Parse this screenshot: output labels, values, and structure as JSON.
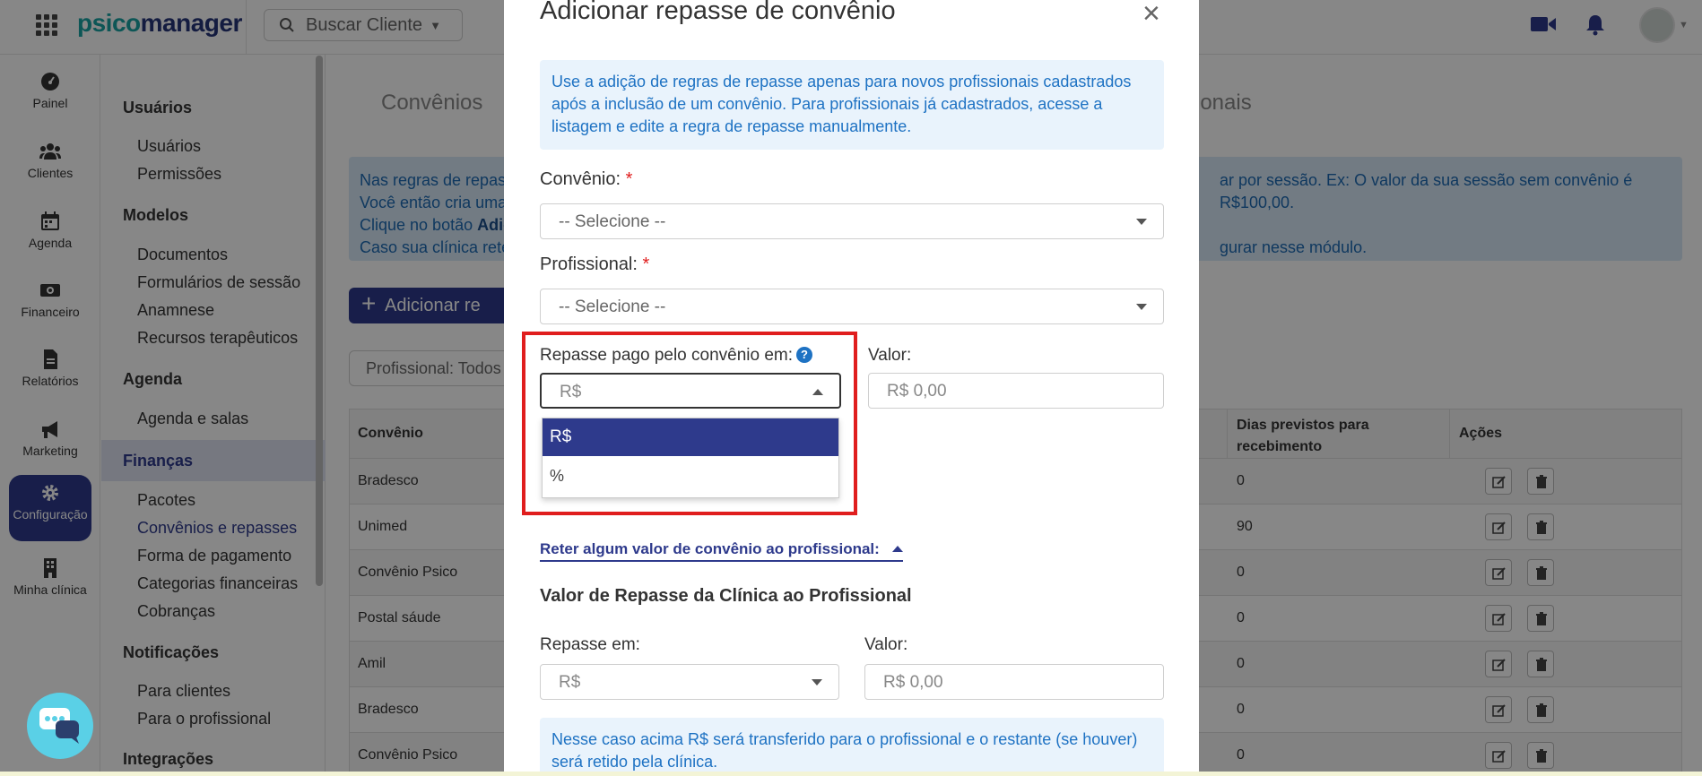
{
  "header": {
    "logo_part1": "psico",
    "logo_part2": "manager",
    "search_label": "Buscar Cliente"
  },
  "rail": [
    {
      "label": "Painel",
      "icon": "gauge-icon"
    },
    {
      "label": "Clientes",
      "icon": "users-icon"
    },
    {
      "label": "Agenda",
      "icon": "calendar-icon"
    },
    {
      "label": "Financeiro",
      "icon": "money-icon"
    },
    {
      "label": "Relatórios",
      "icon": "document-icon"
    },
    {
      "label": "Marketing",
      "icon": "megaphone-icon"
    },
    {
      "label": "Configuração",
      "icon": "gear-icon",
      "active": true
    },
    {
      "label": "Minha clínica",
      "icon": "building-icon"
    }
  ],
  "submenu": {
    "g1": "Usuários",
    "g1_items": [
      "Usuários",
      "Permissões"
    ],
    "g2": "Modelos",
    "g2_items": [
      "Documentos",
      "Formulários de sessão",
      "Anamnese",
      "Recursos terapêuticos"
    ],
    "g3": "Agenda",
    "g3_items": [
      "Agenda e salas"
    ],
    "g4": "Finanças",
    "g4_items": [
      "Pacotes",
      "Convênios e repasses",
      "Forma de pagamento",
      "Categorias financeiras",
      "Cobranças"
    ],
    "g5": "Notificações",
    "g5_items": [
      "Para clientes",
      "Para o profissional"
    ],
    "g6": "Integrações"
  },
  "main": {
    "tab_left": "Convênios",
    "tab_right": "sionais",
    "banner_l1_left": "Nas regras de repass",
    "banner_l1_right": "ar por sessão. Ex: O valor da sua sessão sem convênio é R$100,00.",
    "banner_l2_left": "Você então cria uma",
    "banner_l3_left": "Clique no botão ",
    "banner_l3_bold": "Adic",
    "banner_l4_left": "Caso sua clínica rete",
    "banner_l4_right": "gurar nesse módulo.",
    "add_button": "Adicionar re",
    "filter": "Profissional: Todos",
    "table": {
      "col_convenio": "Convênio",
      "col_dias": "Dias previstos para recebimento",
      "col_acoes": "Ações",
      "rows": [
        {
          "convenio": "Bradesco",
          "dias": "0"
        },
        {
          "convenio": "Unimed",
          "dias": "90"
        },
        {
          "convenio": "Convênio Psico",
          "dias": "0"
        },
        {
          "convenio": "Postal sáude",
          "dias": "0"
        },
        {
          "convenio": "Amil",
          "dias": "0"
        },
        {
          "convenio": "Bradesco",
          "dias": "0"
        },
        {
          "convenio": "Convênio Psico",
          "dias": "0"
        }
      ]
    }
  },
  "modal": {
    "title": "Adicionar repasse de convênio",
    "close": "×",
    "note": "Use a adição de regras de repasse apenas para novos profissionais cadastrados após a inclusão de um convênio. Para profissionais já cadastrados, acesse a listagem e edite a regra de repasse manualmente.",
    "convenio_label": "Convênio:",
    "convenio_placeholder": "-- Selecione --",
    "profissional_label": "Profissional:",
    "profissional_placeholder": "-- Selecione --",
    "required_mark": "*",
    "repasse_pago_label": "Repasse pago pelo convênio em:",
    "help": "?",
    "repasse_pago_value": "R$",
    "valor_label": "Valor:",
    "valor_placeholder": "R$ 0,00",
    "dropdown_options": [
      "R$",
      "%"
    ],
    "reter_link": "Reter algum valor de convênio ao profissional:",
    "section_title": "Valor de Repasse da Clínica ao Profissional",
    "repasse_em_label": "Repasse em:",
    "repasse_em_value": "R$",
    "valor2_label": "Valor:",
    "valor2_placeholder": "R$ 0,00",
    "bottom_note": "Nesse caso acima R$ será transferido para o profissional e o restante (se houver) será retido pela clínica."
  }
}
